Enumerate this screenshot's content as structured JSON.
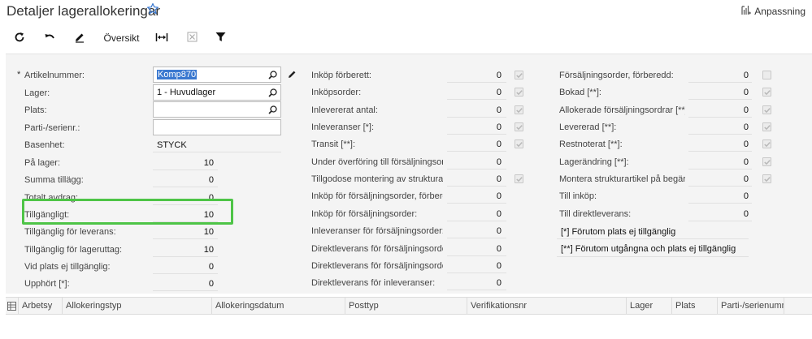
{
  "header": {
    "title": "Detaljer lagerallokeringar",
    "customize_label": "Anpassning"
  },
  "toolbar": {
    "overview_label": "Översikt"
  },
  "left": {
    "artikel_label": "Artikelnummer:",
    "artikel_value": "Komp870",
    "lager_label": "Lager:",
    "lager_value": "1 - Huvudlager",
    "plats_label": "Plats:",
    "plats_value": "",
    "parti_label": "Parti-/serienr.:",
    "parti_value": "",
    "basenhet_label": "Basenhet:",
    "basenhet_value": "STYCK",
    "rows": [
      {
        "label": "På lager:",
        "value": "10"
      },
      {
        "label": "Summa tillägg:",
        "value": "0"
      },
      {
        "label": "Totalt avdrag:",
        "value": "0"
      },
      {
        "label": "Tillgängligt:",
        "value": "10"
      },
      {
        "label": "Tillgänglig för leverans:",
        "value": "10"
      },
      {
        "label": "Tillgänglig för lageruttag:",
        "value": "10"
      },
      {
        "label": "Vid plats ej tillgänglig:",
        "value": "0"
      },
      {
        "label": "Upphört [*]:",
        "value": "0"
      }
    ]
  },
  "middle": {
    "rows": [
      {
        "label": "Inköp förberett:",
        "value": "0",
        "checked": true
      },
      {
        "label": "Inköpsorder:",
        "value": "0",
        "checked": true
      },
      {
        "label": "Inlevererat antal:",
        "value": "0",
        "checked": true
      },
      {
        "label": "Inleveranser [*]:",
        "value": "0",
        "checked": true
      },
      {
        "label": "Transit [**]:",
        "value": "0",
        "checked": true
      },
      {
        "label": "Under överföring till försäljningsorder:",
        "value": "0",
        "checked": null
      },
      {
        "label": "Tillgodose montering av strukturarti...",
        "value": "0",
        "checked": true
      },
      {
        "label": "Inköp för försäljningsorder, förberedd:",
        "value": "0",
        "checked": null
      },
      {
        "label": "Inköp för försäljningsorder:",
        "value": "0",
        "checked": null
      },
      {
        "label": "Inleveranser för försäljningsorder:",
        "value": "0",
        "checked": null
      },
      {
        "label": "Direktleverans för försäljningsorder...",
        "value": "0",
        "checked": null
      },
      {
        "label": "Direktleverans för försäljningsorder:",
        "value": "0",
        "checked": null
      },
      {
        "label": "Direktleverans för inleveranser:",
        "value": "0",
        "checked": null
      }
    ]
  },
  "right": {
    "rows": [
      {
        "label": "Försäljningsorder, förberedd:",
        "value": "0",
        "checked": false
      },
      {
        "label": "Bokad [**]:",
        "value": "0",
        "checked": true
      },
      {
        "label": "Allokerade försäljningsordrar [**]:",
        "value": "0",
        "checked": true
      },
      {
        "label": "Levererad [**]:",
        "value": "0",
        "checked": true
      },
      {
        "label": "Restnoterat [**]:",
        "value": "0",
        "checked": true
      },
      {
        "label": "Lagerändring [**]:",
        "value": "0",
        "checked": true
      },
      {
        "label": "Montera strukturartikel på begäran:",
        "value": "0",
        "checked": true
      },
      {
        "label": "Till inköp:",
        "value": "0",
        "checked": null
      },
      {
        "label": "Till direktleverans:",
        "value": "0",
        "checked": null
      }
    ],
    "legend1": "[*]  Förutom plats ej tillgänglig",
    "legend2": "[**] Förutom utgångna och plats ej tillgänglig"
  },
  "grid": {
    "columns": [
      "Arbetsy",
      "Allokeringstyp",
      "Allokeringsdatum",
      "Posttyp",
      "Verifikationsnr",
      "Lager",
      "Plats",
      "Parti-/serienumm"
    ]
  },
  "colors": {
    "highlight": "#4ec447",
    "selection": "#3a78d0",
    "form_bg": "#f4f4f4"
  }
}
